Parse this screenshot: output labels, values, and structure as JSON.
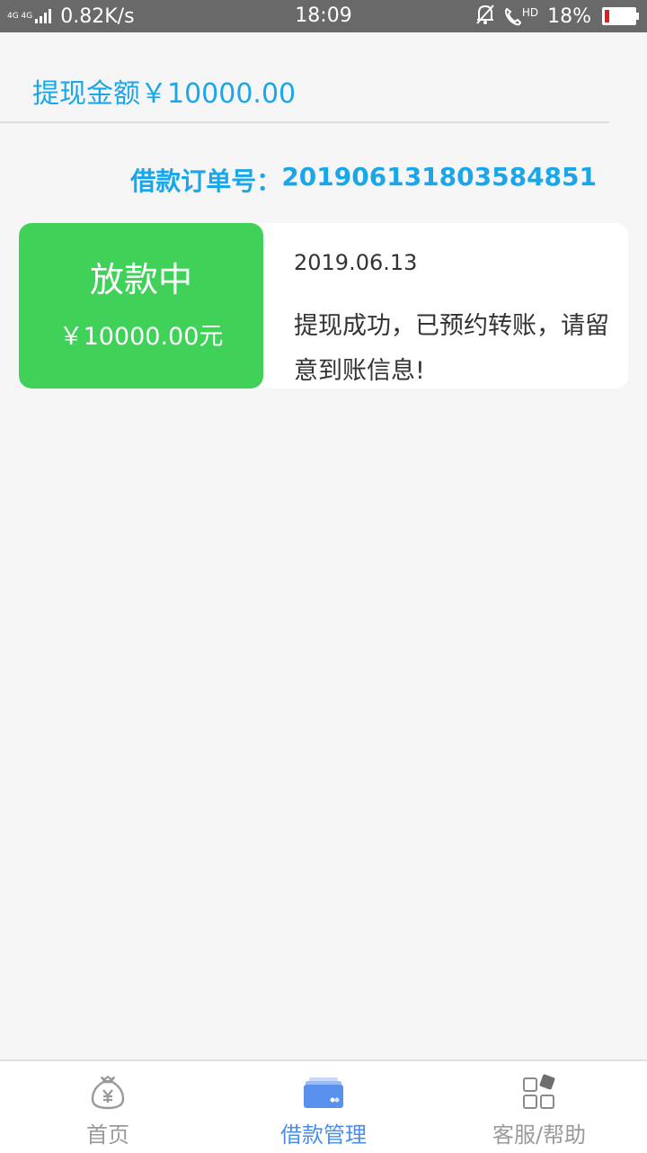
{
  "status_bar": {
    "network": "4G 4G",
    "speed": "0.82K/s",
    "time": "18:09",
    "hd_label": "HD",
    "battery": "18%",
    "battery_level": 0.18,
    "battery_color": "#e02020"
  },
  "header": {
    "withdraw_label": "提现金额￥10000.00"
  },
  "order": {
    "label": "借款订单号：",
    "number": "201906131803584851"
  },
  "record": {
    "status": "放款中",
    "amount": "￥10000.00元",
    "date": "2019.06.13",
    "message": "提现成功，已预约转账，请留意到账信息!",
    "status_color": "#3fd158"
  },
  "tabs": [
    {
      "label": "首页",
      "icon": "money-bag-icon",
      "active": false
    },
    {
      "label": "借款管理",
      "icon": "card-icon",
      "active": true
    },
    {
      "label": "客服/帮助",
      "icon": "grid-icon",
      "active": false
    }
  ],
  "colors": {
    "accent": "#1aa7ea",
    "tab_active": "#4a8eea",
    "tab_inactive": "#9a9a9a"
  }
}
